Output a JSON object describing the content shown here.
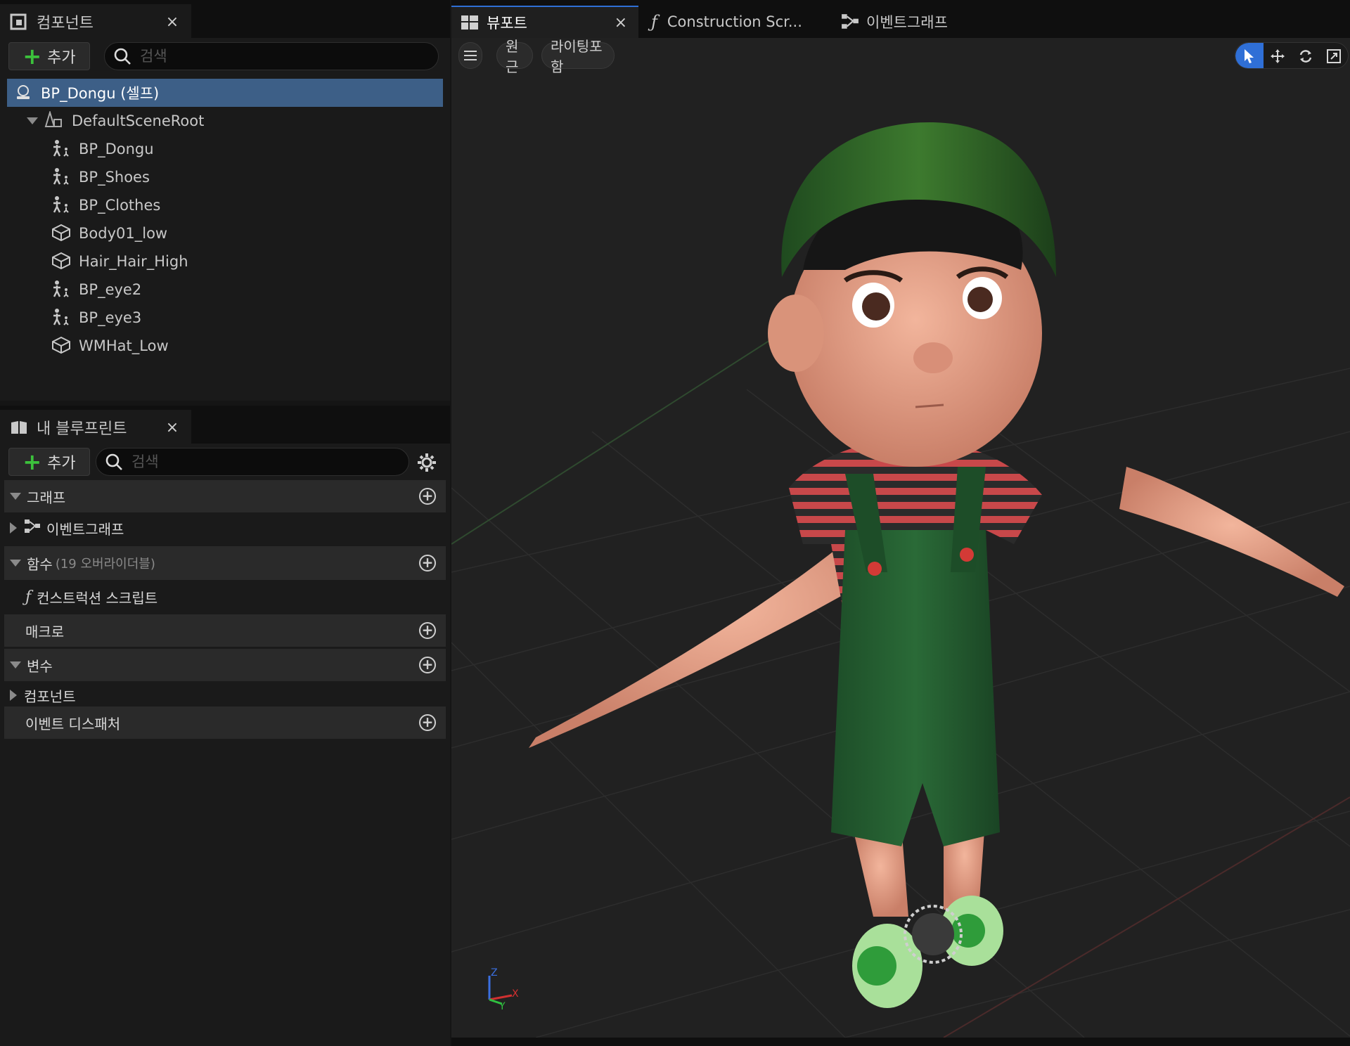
{
  "components_panel": {
    "tab_label": "컴포넌트",
    "close_glyph": "×",
    "add_label": "추가",
    "search_placeholder": "검색",
    "tree": {
      "root": "BP_Dongu (셀프)",
      "scene_root": "DefaultSceneRoot",
      "children": [
        {
          "label": "BP_Dongu",
          "icon": "skeletal-mesh-icon"
        },
        {
          "label": "BP_Shoes",
          "icon": "skeletal-mesh-icon"
        },
        {
          "label": "BP_Clothes",
          "icon": "skeletal-mesh-icon"
        },
        {
          "label": "Body01_low",
          "icon": "static-mesh-icon"
        },
        {
          "label": "Hair_Hair_High",
          "icon": "static-mesh-icon"
        },
        {
          "label": "BP_eye2",
          "icon": "skeletal-mesh-icon"
        },
        {
          "label": "BP_eye3",
          "icon": "skeletal-mesh-icon"
        },
        {
          "label": "WMHat_Low",
          "icon": "static-mesh-icon"
        }
      ]
    }
  },
  "my_blueprint_panel": {
    "tab_label": "내 블루프린트",
    "close_glyph": "×",
    "add_label": "추가",
    "search_placeholder": "검색",
    "categories": {
      "graph": "그래프",
      "event_graph": "이벤트그래프",
      "functions": "함수",
      "functions_note": "(19 오버라이더블)",
      "construction_script": "컨스트럭션 스크립트",
      "macros": "매크로",
      "variables": "변수",
      "components": "컴포넌트",
      "event_dispatchers": "이벤트 디스패처"
    }
  },
  "editor_tabs": {
    "viewport": "뷰포트",
    "construction_script": "Construction Scr...",
    "event_graph": "이벤트그래프",
    "close_glyph": "×"
  },
  "viewport_toolbar": {
    "perspective": "원근",
    "lighting": "라이팅포함"
  },
  "gizmo": {
    "x": "X",
    "y": "Y",
    "z": "Z"
  },
  "colors": {
    "selection": "#3d5f87",
    "accent": "#2f6fd6",
    "add_green": "#3cc23c"
  }
}
